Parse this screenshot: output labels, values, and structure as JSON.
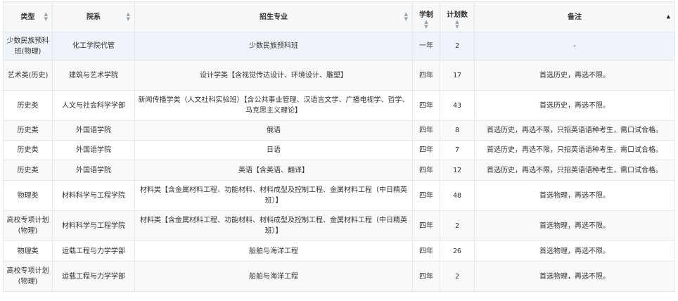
{
  "headers": {
    "type": "类型",
    "dept": "院系",
    "major": "招生专业",
    "years": "学制",
    "plan": "计划数",
    "note": "备注"
  },
  "sort_icons": {
    "up": "▲",
    "down": "▼"
  },
  "rows": [
    {
      "type": "少数民族预科班(物理)",
      "dept": "化工学院代管",
      "major": "少数民族预科班",
      "years": "一年",
      "plan": "2",
      "note": "-"
    },
    {
      "type": "艺术类(历史)",
      "dept": "建筑与艺术学院",
      "major": "设计学类【含视觉传达设计、环境设计、雕塑】",
      "years": "四年",
      "plan": "17",
      "note": "首选历史，再选不限。"
    },
    {
      "type": "历史类",
      "dept": "人文与社会科学学部",
      "major": "新闻传播学类（人文社科实验班）【含公共事业管理、汉语言文学、广播电视学、哲学、马克思主义理论】",
      "years": "四年",
      "plan": "43",
      "note": "首选历史，再选不限。"
    },
    {
      "type": "历史类",
      "dept": "外国语学院",
      "major": "俄语",
      "years": "四年",
      "plan": "8",
      "note": "首选历史，再选不限，只招英语语种考生，需口试合格。"
    },
    {
      "type": "历史类",
      "dept": "外国语学院",
      "major": "日语",
      "years": "四年",
      "plan": "7",
      "note": "首选历史，再选不限，只招英语语种考生，需口试合格。"
    },
    {
      "type": "历史类",
      "dept": "外国语学院",
      "major": "英语【含英语、翻译】",
      "years": "四年",
      "plan": "12",
      "note": "首选历史，再选不限，只招英语语种考生，需口试合格。"
    },
    {
      "type": "物理类",
      "dept": "材料科学与工程学院",
      "major": "材料类【含金属材料工程、功能材料、材料成型及控制工程、金属材料工程（中日精英班）】",
      "years": "四年",
      "plan": "48",
      "note": "首选物理，再选不限。"
    },
    {
      "type": "高校专项计划(物理)",
      "dept": "材料科学与工程学院",
      "major": "材料类【含金属材料工程、功能材料、材料成型及控制工程、金属材料工程（中日精英班）】",
      "years": "四年",
      "plan": "2",
      "note": "首选物理，再选不限。"
    },
    {
      "type": "物理类",
      "dept": "运载工程与力学学部",
      "major": "船舶与海洋工程",
      "years": "四年",
      "plan": "26",
      "note": "首选物理，再选不限。"
    },
    {
      "type": "高校专项计划(物理)",
      "dept": "运载工程与力学学部",
      "major": "船舶与海洋工程",
      "years": "四年",
      "plan": "2",
      "note": "首选物理，再选不限。"
    }
  ]
}
